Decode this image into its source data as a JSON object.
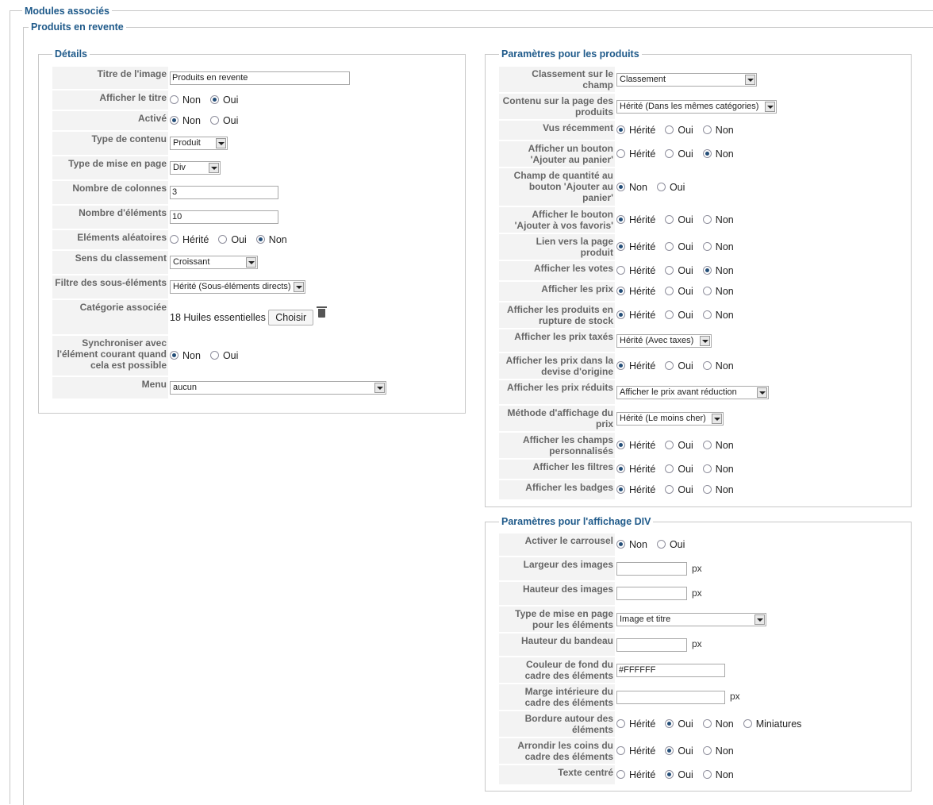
{
  "outer_legend": "Modules associés",
  "inner_legend": "Produits en revente",
  "details": {
    "legend": "Détails",
    "image_title_label": "Titre de l'image",
    "image_title_value": "Produits en revente",
    "show_title_label": "Afficher le titre",
    "active_label": "Activé",
    "content_type_label": "Type de contenu",
    "content_type_value": "Produit",
    "layout_type_label": "Type de mise en page",
    "layout_type_value": "Div",
    "columns_label": "Nombre de colonnes",
    "columns_value": "3",
    "items_label": "Nombre d'éléments",
    "items_value": "10",
    "random_label": "Eléments aléatoires",
    "order_dir_label": "Sens du classement",
    "order_dir_value": "Croissant",
    "sub_filter_label": "Filtre des sous-éléments",
    "sub_filter_value": "Hérité (Sous-éléments directs)",
    "category_label": "Catégorie associée",
    "category_value": "18 Huiles essentielles",
    "choose_label": "Choisir",
    "sync_label": "Synchroniser avec l'élément courant quand cela est possible",
    "menu_label": "Menu",
    "menu_value": "aucun"
  },
  "opts": {
    "non": "Non",
    "oui": "Oui",
    "herite": "Hérité",
    "miniatures": "Miniatures",
    "px": "px"
  },
  "product_params": {
    "legend": "Paramètres pour les produits",
    "ordering_label": "Classement sur le champ",
    "ordering_value": "Classement",
    "content_label": "Contenu sur la page des produits",
    "content_value": "Hérité (Dans les mêmes catégories)",
    "recent_label": "Vus récemment",
    "add_cart_label": "Afficher un bouton 'Ajouter au panier'",
    "qty_label": "Champ de quantité au bouton 'Ajouter au panier'",
    "wishlist_label": "Afficher le bouton 'Ajouter à vos favoris'",
    "link_label": "Lien vers la page produit",
    "votes_label": "Afficher les votes",
    "prices_label": "Afficher les prix",
    "out_stock_label": "Afficher les produits en rupture de stock",
    "taxed_label": "Afficher les prix taxés",
    "taxed_value": "Hérité (Avec taxes)",
    "orig_currency_label": "Afficher les prix dans la devise d'origine",
    "discount_label": "Afficher les prix réduits",
    "discount_value": "Afficher le prix avant réduction",
    "price_method_label": "Méthode d'affichage du prix",
    "price_method_value": "Hérité (Le moins cher)",
    "custom_fields_label": "Afficher les champs personnalisés",
    "filters_label": "Afficher les filtres",
    "badges_label": "Afficher les badges"
  },
  "div_params": {
    "legend": "Paramètres pour l'affichage DIV",
    "carousel_label": "Activer le carrousel",
    "img_width_label": "Largeur des images",
    "img_height_label": "Hauteur des images",
    "item_layout_label": "Type de mise en page pour les éléments",
    "item_layout_value": "Image et titre",
    "banner_height_label": "Hauteur du bandeau",
    "bg_color_label": "Couleur de fond du cadre des éléments",
    "bg_color_value": "#FFFFFF",
    "padding_label": "Marge intérieure du cadre des éléments",
    "border_label": "Bordure autour des éléments",
    "rounded_label": "Arrondir les coins du cadre des éléments",
    "center_text_label": "Texte centré"
  }
}
